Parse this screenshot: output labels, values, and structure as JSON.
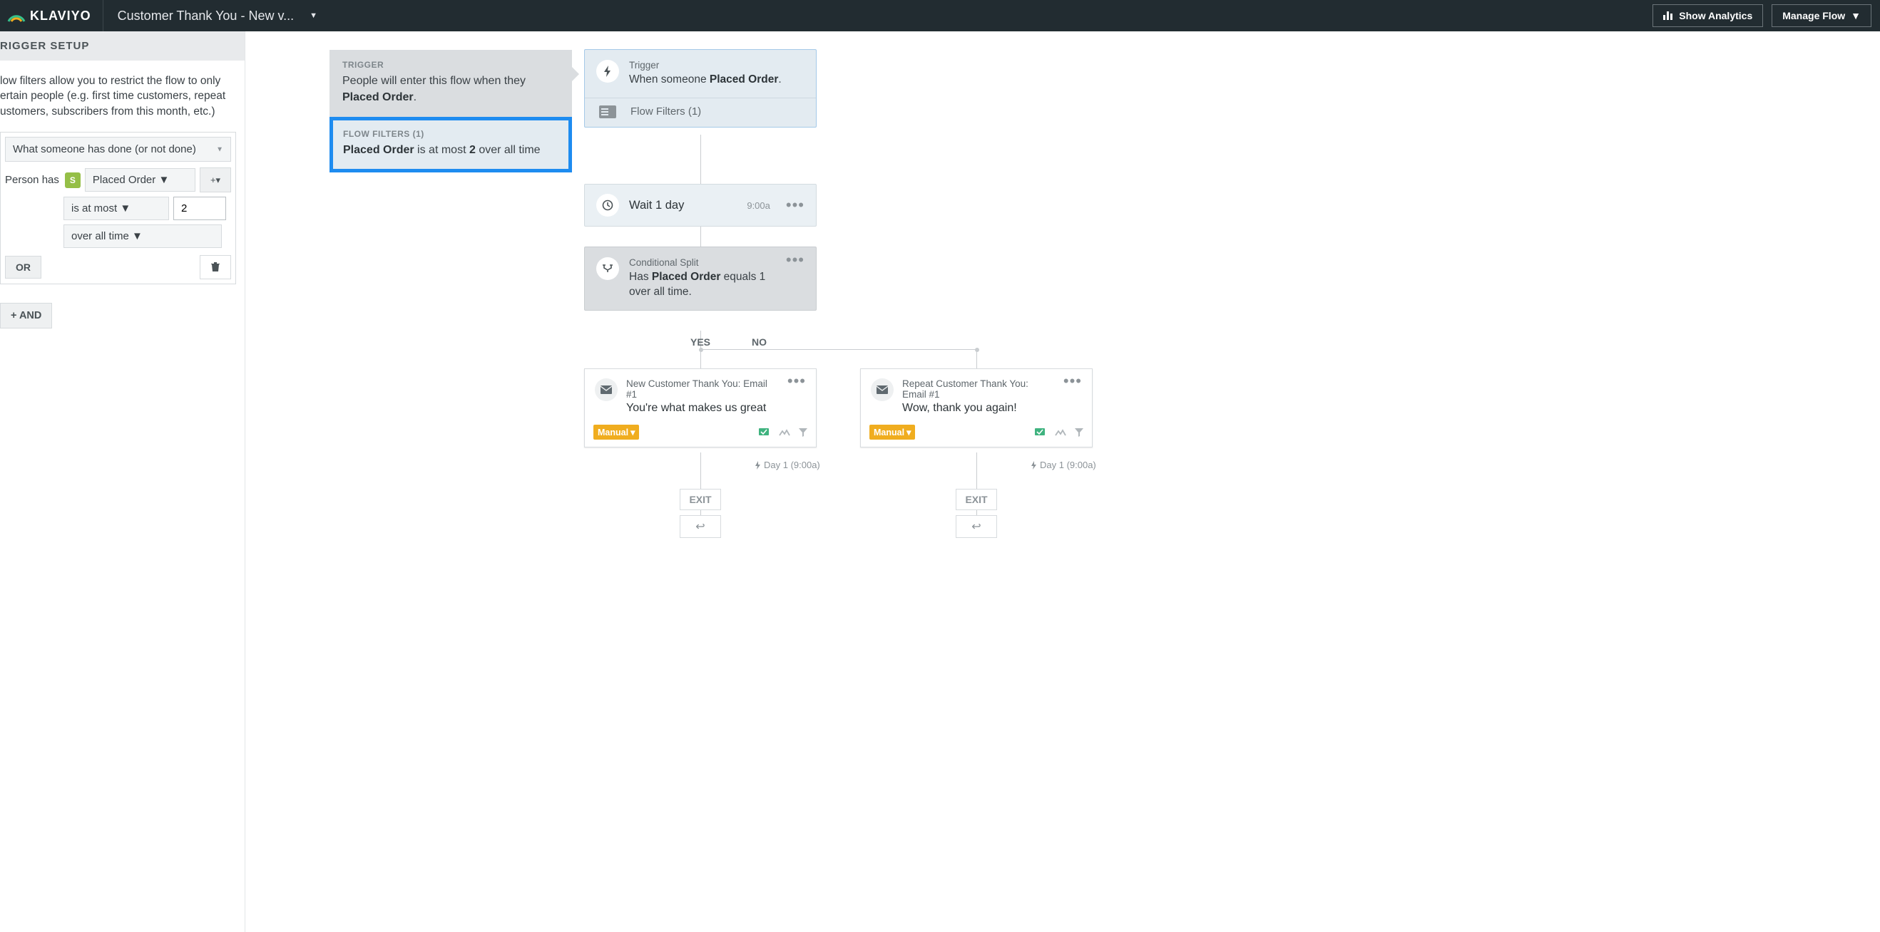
{
  "topbar": {
    "brand": "KLAVIYO",
    "flow_name": "Customer Thank You - New v...",
    "show_analytics": "Show Analytics",
    "manage_flow": "Manage Flow"
  },
  "panel": {
    "header": "RIGGER SETUP",
    "help": "low filters allow you to restrict the flow to only ertain people (e.g. first time customers, repeat ustomers, subscribers from this month, etc.)",
    "condition_type": "What someone has done (or not done)",
    "person_has": "Person has",
    "metric": "Placed Order",
    "comparator": "is at most",
    "value": "2",
    "timeframe": "over all time",
    "or": "OR",
    "and": "+ AND"
  },
  "popover": {
    "trigger_label": "TRIGGER",
    "trigger_text_pre": "People will enter this flow when they ",
    "trigger_action": "Placed Order",
    "filters_label": "FLOW FILTERS (1)",
    "filter_metric": "Placed Order",
    "filter_mid": " is at most ",
    "filter_val": "2",
    "filter_suffix": " over all time"
  },
  "nodes": {
    "trigger": {
      "title": "Trigger",
      "pre": "When someone ",
      "action": "Placed Order",
      "filters_label": "Flow Filters (1)"
    },
    "wait": {
      "text": "Wait 1 day",
      "time": "9:00a"
    },
    "cond": {
      "title": "Conditional Split",
      "pre": "Has ",
      "action": "Placed Order",
      "suffix": " equals 1 over all time."
    },
    "yes": "YES",
    "no": "NO",
    "email1": {
      "title": "New Customer Thank You: Email #1",
      "subject": "You're what makes us great",
      "badge": "Manual"
    },
    "email2": {
      "title": "Repeat Customer Thank You: Email #1",
      "subject": "Wow, thank you again!",
      "badge": "Manual"
    },
    "day_label": "Day 1 (9:00a)",
    "exit": "EXIT",
    "return_glyph": "↩"
  }
}
